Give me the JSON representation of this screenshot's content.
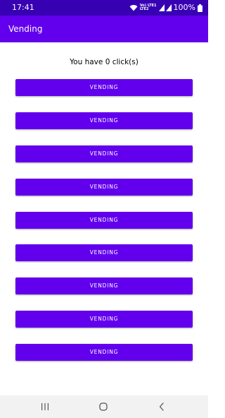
{
  "status_bar": {
    "time": "17:41",
    "network_top": "Vo) LTE1",
    "network_bottom": "LTE2",
    "battery": "100%",
    "icons": [
      "wifi-icon",
      "signal-icon",
      "battery-icon"
    ]
  },
  "app_bar": {
    "title": "Vending"
  },
  "main": {
    "counter_text": "You have 0 click(s)",
    "buttons": [
      {
        "label": "VENDING"
      },
      {
        "label": "VENDING"
      },
      {
        "label": "VENDING"
      },
      {
        "label": "VENDING"
      },
      {
        "label": "VENDING"
      },
      {
        "label": "VENDING"
      },
      {
        "label": "VENDING"
      },
      {
        "label": "VENDING"
      },
      {
        "label": "VENDING"
      }
    ]
  },
  "nav_bar": {
    "icons": [
      "recents-icon",
      "home-icon",
      "back-icon"
    ]
  },
  "colors": {
    "status_bar": "#3700b3",
    "primary": "#6200ee",
    "nav_bar": "#f2f2f2"
  }
}
